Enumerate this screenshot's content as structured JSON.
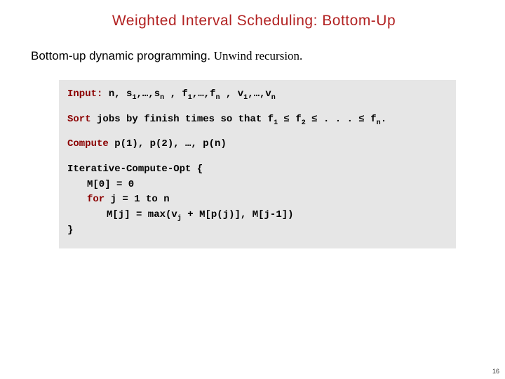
{
  "title": "Weighted Interval Scheduling:  Bottom-Up",
  "subtitle": {
    "partA": "Bottom-up dynamic programming.",
    "partB": "Unwind recursion."
  },
  "code": {
    "input": {
      "kw": "Input:",
      "rest_a": " n, s",
      "rest_b": ",…,s",
      "rest_c": " , f",
      "rest_d": ",…,f",
      "rest_e": " , v",
      "rest_f": ",…,v",
      "sub1": "1",
      "subn": "n"
    },
    "sort": {
      "kw": "Sort",
      "rest_a": " jobs by finish times so that f",
      "rest_b": " ≤ f",
      "rest_c": " ≤ . . . ≤ f",
      "rest_d": ".",
      "sub1": "1",
      "sub2": "2",
      "subn": "n"
    },
    "compute": {
      "kw": "Compute",
      "rest": " p(1), p(2), …, p(n)"
    },
    "algo": {
      "l1": "Iterative-Compute-Opt {",
      "l2": "M[0] = 0",
      "l3_kw": "for",
      "l3_rest": " j = 1 to n",
      "l4_a": "M[j] = max(v",
      "l4_sub": "j",
      "l4_b": " + M[p(j)], M[j-1])",
      "l5": "}"
    }
  },
  "pagenum": "16"
}
